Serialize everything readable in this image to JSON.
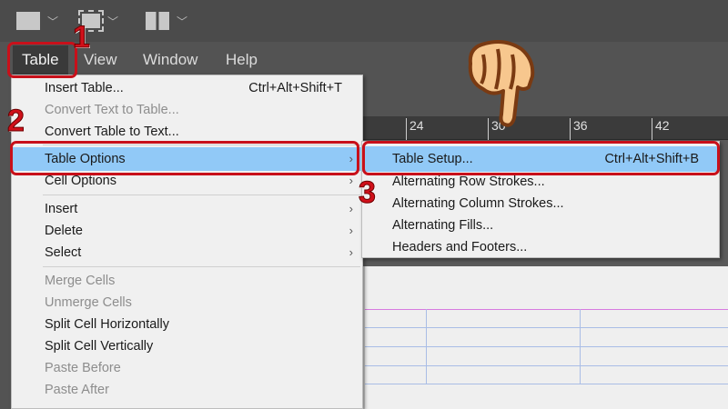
{
  "toolbar": {
    "icons": [
      "frame-grid-icon",
      "screen-mode-icon",
      "arrange-documents-icon"
    ]
  },
  "menubar": [
    "Table",
    "View",
    "Window",
    "Help"
  ],
  "ruler": [
    "24",
    "30",
    "36",
    "42"
  ],
  "menu": {
    "items": [
      {
        "label": "Insert Table...",
        "shortcut": "Ctrl+Alt+Shift+T"
      },
      {
        "label": "Convert Text to Table...",
        "disabled": true
      },
      {
        "label": "Convert Table to Text..."
      },
      {
        "label": "Table Options",
        "submenu": true,
        "highlighted": true
      },
      {
        "label": "Cell Options",
        "submenu": true
      },
      {
        "label": "Insert",
        "submenu": true
      },
      {
        "label": "Delete",
        "submenu": true
      },
      {
        "label": "Select",
        "submenu": true
      },
      {
        "label": "Merge Cells",
        "disabled": true
      },
      {
        "label": "Unmerge Cells",
        "disabled": true
      },
      {
        "label": "Split Cell Horizontally"
      },
      {
        "label": "Split Cell Vertically"
      },
      {
        "label": "Paste Before",
        "disabled": true
      },
      {
        "label": "Paste After",
        "disabled": true
      }
    ]
  },
  "submenu": {
    "items": [
      {
        "label": "Table Setup...",
        "shortcut": "Ctrl+Alt+Shift+B",
        "highlighted": true
      },
      {
        "label": "Alternating Row Strokes..."
      },
      {
        "label": "Alternating Column Strokes..."
      },
      {
        "label": "Alternating Fills..."
      },
      {
        "label": "Headers and Footers..."
      }
    ]
  },
  "annotations": {
    "step1": "1",
    "step2": "2",
    "step3": "3",
    "color": "#c8101a"
  }
}
